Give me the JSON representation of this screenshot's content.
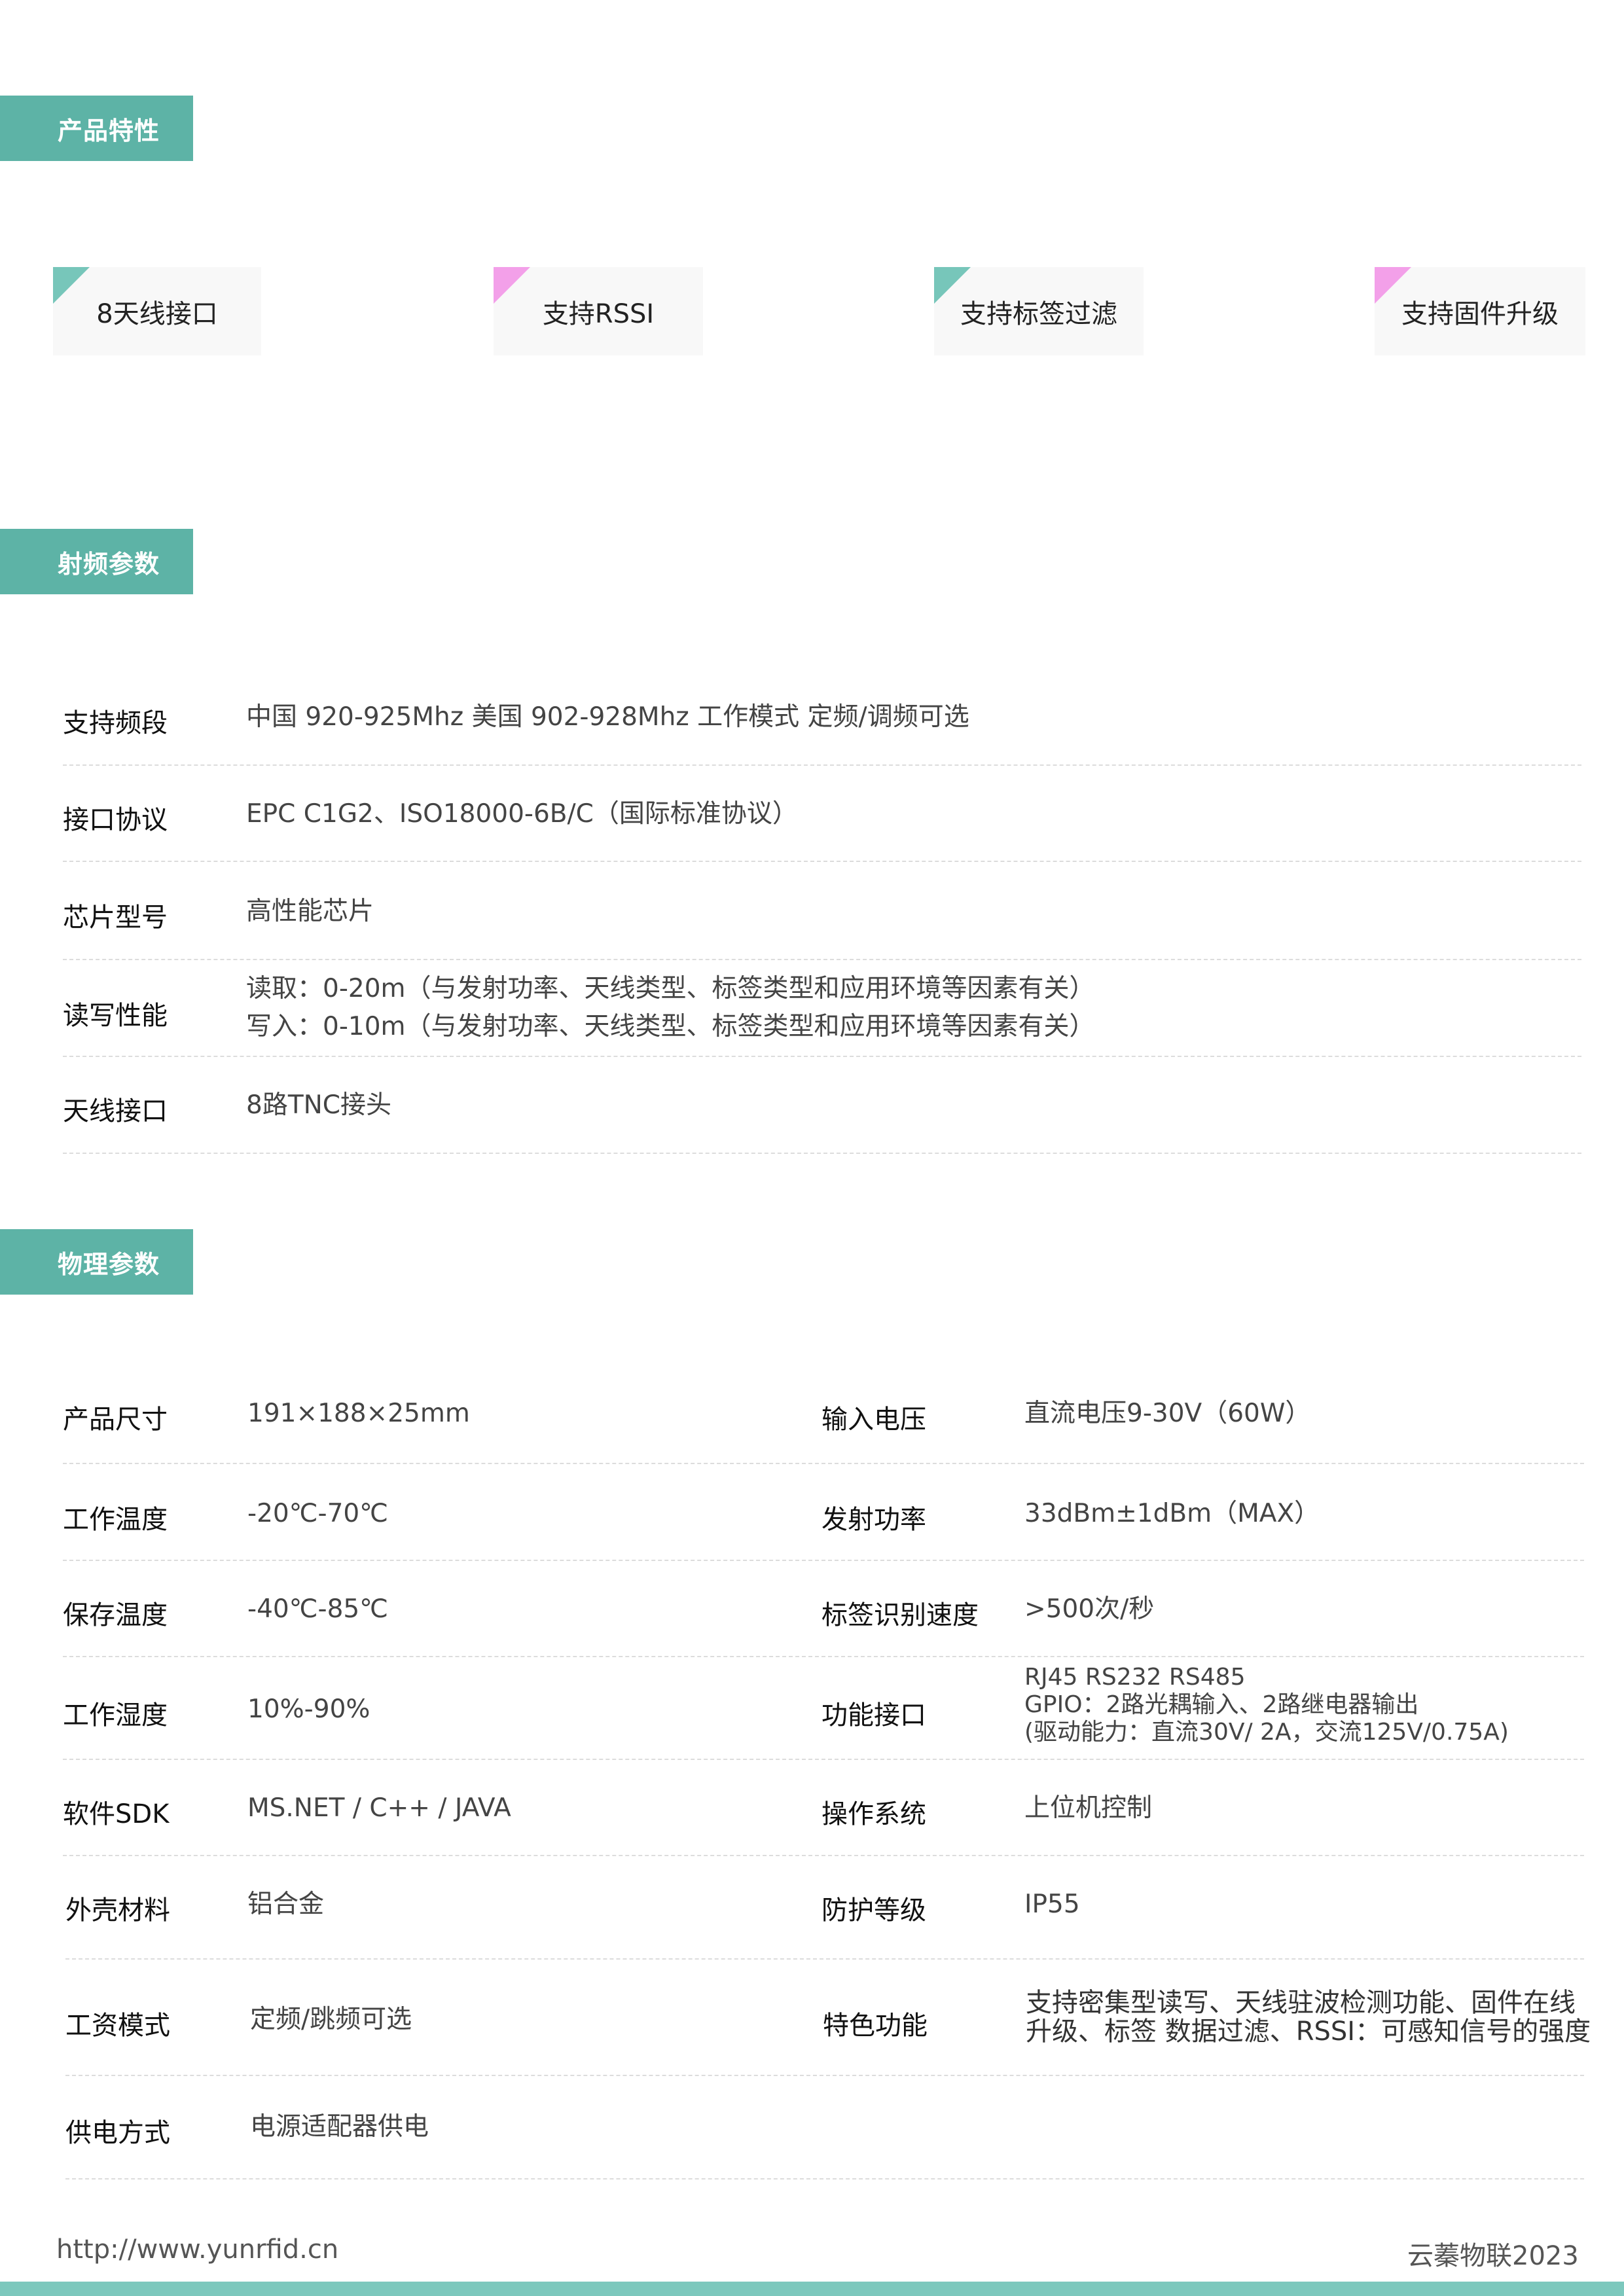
{
  "sections": {
    "features_title": "产品特性",
    "rf_title": "射频参数",
    "physical_title": "物理参数"
  },
  "features": [
    "8天线接口",
    "支持RSSI",
    "支持标签过滤",
    "支持固件升级"
  ],
  "rf_params": [
    {
      "label": "支持频段",
      "lines": [
        "中国 920-925Mhz    美国 902-928Mhz  工作模式 定频/调频可选"
      ]
    },
    {
      "label": "接口协议",
      "lines": [
        "EPC C1G2、ISO18000-6B/C（国际标准协议）"
      ]
    },
    {
      "label": "芯片型号",
      "lines": [
        "高性能芯片"
      ]
    },
    {
      "label": "读写性能",
      "lines": [
        "读取：0-20m（与发射功率、天线类型、标签类型和应用环境等因素有关）",
        "写入：0-10m（与发射功率、天线类型、标签类型和应用环境等因素有关）"
      ]
    },
    {
      "label": "天线接口",
      "lines": [
        "8路TNC接头"
      ]
    }
  ],
  "physical_params": [
    {
      "left_label": "产品尺寸",
      "left_value": "191×188×25mm",
      "right_label": "输入电压",
      "right_lines": [
        "直流电压9-30V（60W）"
      ]
    },
    {
      "left_label": "工作温度",
      "left_value": "-20℃-70℃",
      "right_label": "发射功率",
      "right_lines": [
        "33dBm±1dBm（MAX）"
      ]
    },
    {
      "left_label": "保存温度",
      "left_value": "-40℃-85℃",
      "right_label": "标签识别速度",
      "right_lines": [
        ">500次/秒"
      ]
    },
    {
      "left_label": "工作湿度",
      "left_value": "10%-90%",
      "right_label": "功能接口",
      "right_lines": [
        "RJ45 RS232 RS485",
        "GPIO：2路光耦输入、2路继电器输出",
        "(驱动能力：直流30V/ 2A，交流125V/0.75A)"
      ]
    },
    {
      "left_label": "软件SDK",
      "left_value": "MS.NET / C++ / JAVA",
      "right_label": "操作系统",
      "right_lines": [
        "上位机控制"
      ]
    },
    {
      "left_label": "外壳材料",
      "left_value": "铝合金",
      "right_label": "防护等级",
      "right_lines": [
        "IP55"
      ]
    },
    {
      "left_label": "工资模式",
      "left_value": "定频/跳频可选",
      "right_label": "特色功能",
      "right_lines": [
        "支持密集型读写、天线驻波检测功能、固件在线",
        "升级、标签 数据过滤、RSSI：可感知信号的强度"
      ]
    },
    {
      "left_label": "供电方式",
      "left_value": "电源适配器供电",
      "right_label": "",
      "right_lines": []
    }
  ],
  "footer": {
    "website": "http://www.yunrfid.cn",
    "brand": "云蓁物联2023"
  },
  "colors": {
    "accent_teal": "#5db3a6",
    "corner_teal": "#77c6ba",
    "corner_pink": "#f3a0e9"
  }
}
